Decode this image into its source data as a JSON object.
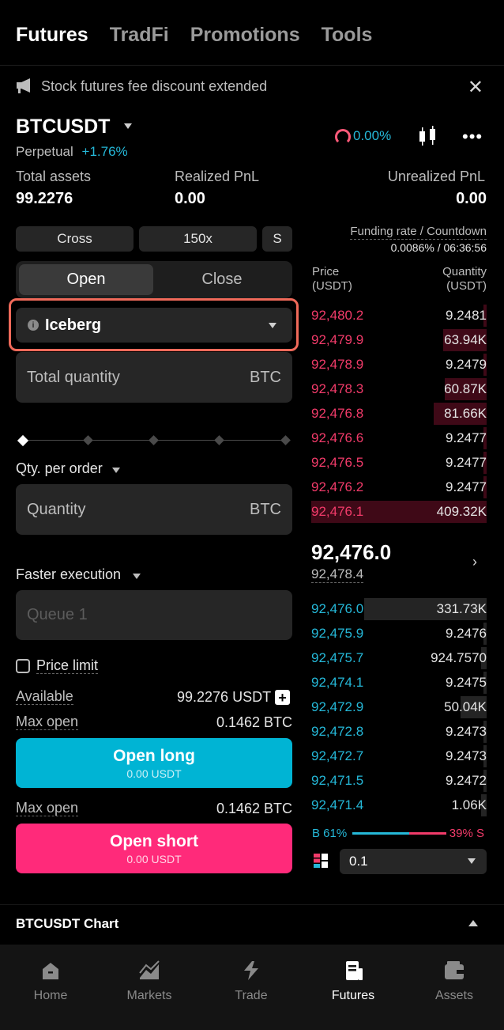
{
  "top_tabs": [
    {
      "label": "Futures",
      "active": true
    },
    {
      "label": "TradFi",
      "active": false
    },
    {
      "label": "Promotions",
      "active": false
    },
    {
      "label": "Tools",
      "active": false
    }
  ],
  "banner": {
    "text": "Stock futures fee discount extended",
    "close": "✕"
  },
  "pair": {
    "symbol": "BTCUSDT",
    "type": "Perpetual",
    "change": "+1.76%",
    "funding_indicator": "0.00%"
  },
  "metrics": {
    "total_assets_label": "Total assets",
    "total_assets_value": "99.2276",
    "realized_label": "Realized PnL",
    "realized_value": "0.00",
    "unrealized_label": "Unrealized PnL",
    "unrealized_value": "0.00"
  },
  "margin": {
    "mode": "Cross",
    "leverage": "150x",
    "side": "S"
  },
  "funding": {
    "label": "Funding rate / Countdown",
    "value": "0.0086% / 06:36:56"
  },
  "order_tabs": {
    "open": "Open",
    "close": "Close"
  },
  "order_type": "Iceberg",
  "total_quantity": {
    "placeholder": "Total quantity",
    "unit": "BTC"
  },
  "qty_per_order": {
    "label": "Qty. per order",
    "placeholder": "Quantity",
    "unit": "BTC"
  },
  "faster_execution": {
    "label": "Faster execution",
    "placeholder": "Queue 1"
  },
  "price_limit": "Price limit",
  "available": {
    "label": "Available",
    "value": "99.2276 USDT"
  },
  "max_open_long": {
    "label": "Max open",
    "value": "0.1462 BTC"
  },
  "max_open_short": {
    "label": "Max open",
    "value": "0.1462 BTC"
  },
  "buttons": {
    "long_label": "Open long",
    "long_sub": "0.00 USDT",
    "short_label": "Open short",
    "short_sub": "0.00 USDT"
  },
  "orderbook": {
    "price_header": "Price\n(USDT)",
    "qty_header": "Quantity\n(USDT)",
    "asks": [
      {
        "price": "92,480.2",
        "qty": "9.2481",
        "depth": 0.02
      },
      {
        "price": "92,479.9",
        "qty": "63.94K",
        "depth": 0.25
      },
      {
        "price": "92,478.9",
        "qty": "9.2479",
        "depth": 0.02
      },
      {
        "price": "92,478.3",
        "qty": "60.87K",
        "depth": 0.24
      },
      {
        "price": "92,476.8",
        "qty": "81.66K",
        "depth": 0.3
      },
      {
        "price": "92,476.6",
        "qty": "9.2477",
        "depth": 0.02
      },
      {
        "price": "92,476.5",
        "qty": "9.2477",
        "depth": 0.02
      },
      {
        "price": "92,476.2",
        "qty": "9.2477",
        "depth": 0.02
      },
      {
        "price": "92,476.1",
        "qty": "409.32K",
        "depth": 1.0
      }
    ],
    "mid_price": "92,476.0",
    "mark_price": "92,478.4",
    "bids": [
      {
        "price": "92,476.0",
        "qty": "331.73K",
        "depth": 0.7
      },
      {
        "price": "92,475.9",
        "qty": "9.2476",
        "depth": 0.02
      },
      {
        "price": "92,475.7",
        "qty": "924.7570",
        "depth": 0.03
      },
      {
        "price": "92,474.1",
        "qty": "9.2475",
        "depth": 0.02
      },
      {
        "price": "92,472.9",
        "qty": "50.04K",
        "depth": 0.15
      },
      {
        "price": "92,472.8",
        "qty": "9.2473",
        "depth": 0.02
      },
      {
        "price": "92,472.7",
        "qty": "9.2473",
        "depth": 0.02
      },
      {
        "price": "92,471.5",
        "qty": "9.2472",
        "depth": 0.02
      },
      {
        "price": "92,471.4",
        "qty": "1.06K",
        "depth": 0.03
      }
    ],
    "buy_ratio": "B 61%",
    "sell_ratio": "39% S",
    "depth_step": "0.1"
  },
  "chart_section": "BTCUSDT  Chart",
  "bottom_nav": [
    {
      "label": "Home",
      "active": false
    },
    {
      "label": "Markets",
      "active": false
    },
    {
      "label": "Trade",
      "active": false
    },
    {
      "label": "Futures",
      "active": true
    },
    {
      "label": "Assets",
      "active": false
    }
  ],
  "colors": {
    "ask": "#f23b6a",
    "bid": "#25b8d8",
    "long": "#00b4d4",
    "short": "#ff2a7a",
    "highlight": "#f06a5a"
  }
}
